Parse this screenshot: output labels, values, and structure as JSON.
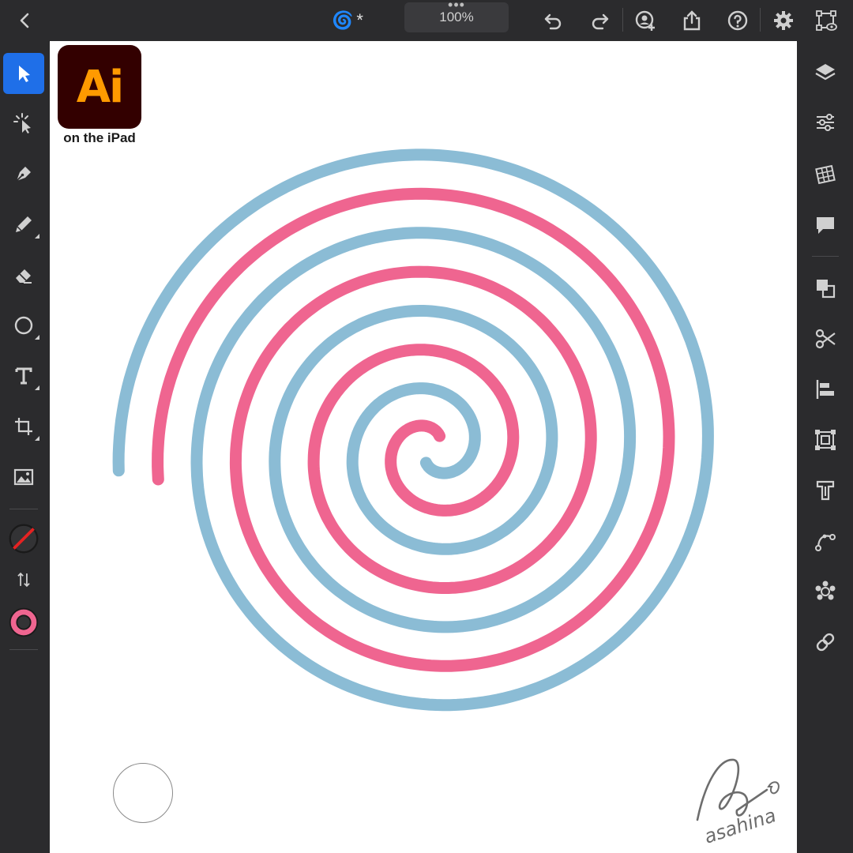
{
  "topbar": {
    "back_icon": "chevron-left-icon",
    "doc_icon": "cyclone-icon",
    "doc_icon_glyph": "🌀",
    "doc_modified": "*",
    "zoom_dots": "•••",
    "zoom": "100%",
    "icons": [
      "undo-icon",
      "redo-icon",
      "invite-user-icon",
      "share-icon",
      "help-icon",
      "settings-icon",
      "preview-icon"
    ]
  },
  "left_tools": {
    "items": [
      "selection-arrow-icon",
      "direct-selection-icon",
      "pen-icon",
      "pencil-icon",
      "eraser-icon",
      "ellipse-icon",
      "type-icon",
      "transform-icon",
      "image-icon"
    ],
    "active": "selection-arrow-icon",
    "fill": "none",
    "stroke_color": "#ef6590"
  },
  "right_tools": {
    "items": [
      "layers-icon",
      "properties-icon",
      "libraries-icon",
      "comments-icon",
      "arrange-icon",
      "scissors-icon",
      "align-icon",
      "repeat-icon",
      "type-panel-icon",
      "path-icon",
      "radial-repeat-icon",
      "link-icon"
    ]
  },
  "canvas": {
    "logo_text": "Ai",
    "logo_caption": "on the iPad",
    "spiral_colors": {
      "pink": "#ef6590",
      "blue": "#8bbcd5"
    },
    "signature": "asahina"
  }
}
